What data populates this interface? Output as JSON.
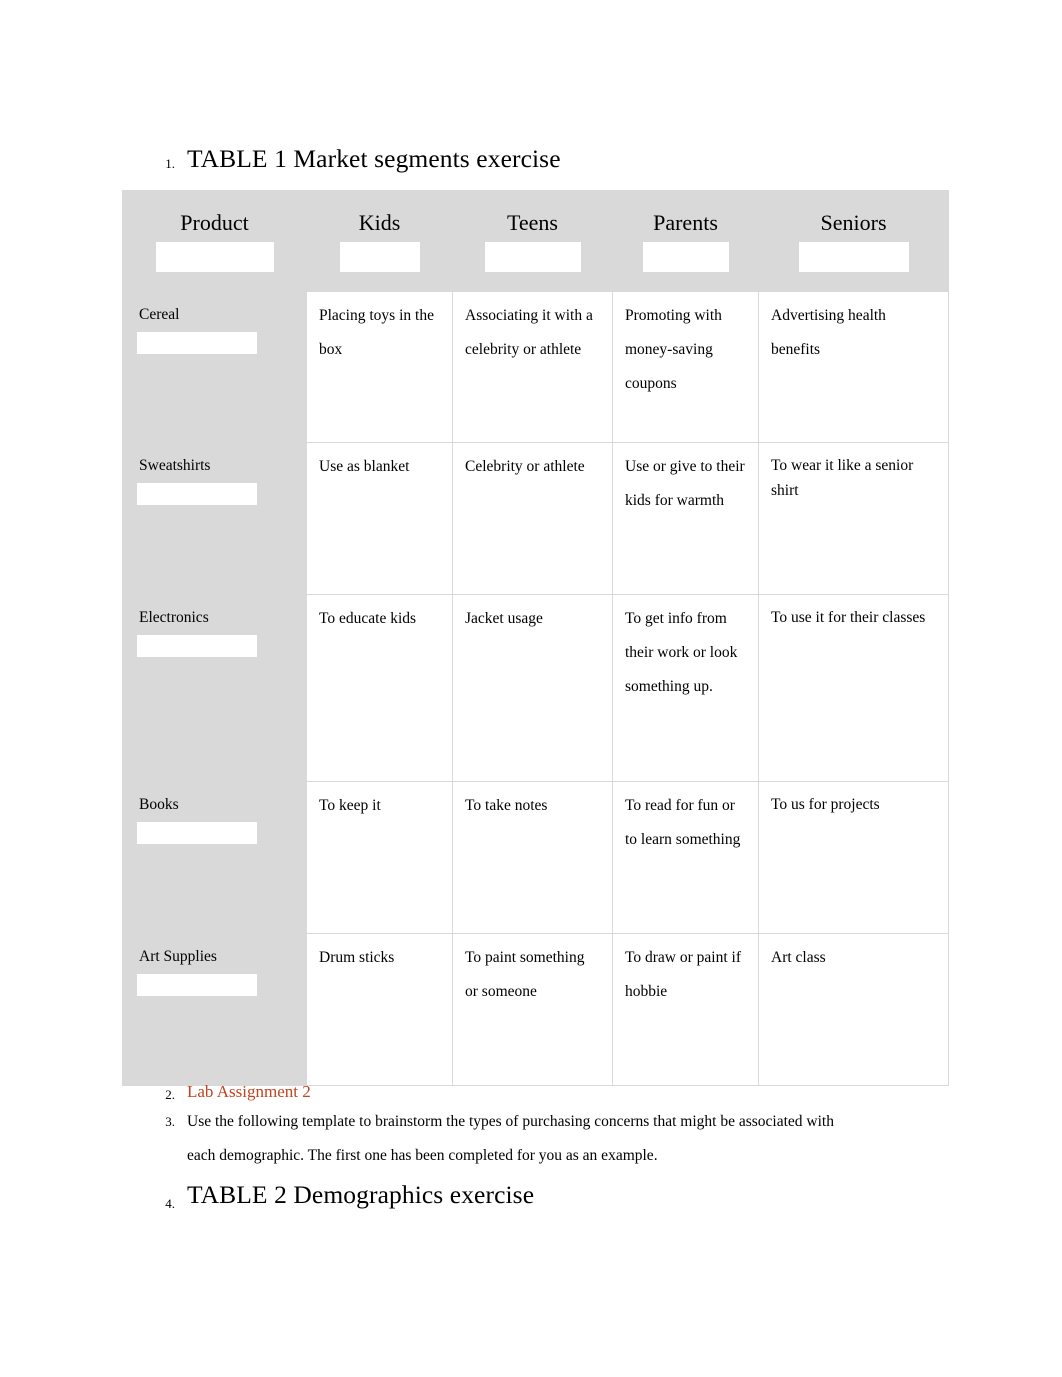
{
  "document": {
    "list_markers": [
      "1.",
      "2.",
      "3.",
      "4."
    ],
    "heading_table1": "TABLE 1 Market segments exercise",
    "lab_assignment_link": "Lab Assignment 2",
    "instructions": "Use the following template to brainstorm the types of purchasing concerns that might be associated with each demographic. The first one has been completed for you as an example.",
    "heading_table2": "TABLE 2 Demographics exercise",
    "accent_color": "#c0441f",
    "header_fill": "#d9d9d9"
  },
  "table1": {
    "headers": [
      "Product",
      "Kids",
      "Teens",
      "Parents",
      "Seniors"
    ],
    "rows": [
      {
        "product": "Cereal",
        "kids": "Placing toys in the box",
        "teens": "Associating it with a celebrity or athlete",
        "parents": "Promoting with money-saving coupons",
        "seniors": "Advertising health benefits"
      },
      {
        "product": "Sweatshirts",
        "kids": "Use as blanket",
        "teens": "Celebrity or athlete",
        "parents": "Use or give to their kids for warmth",
        "seniors": "To wear it like a senior shirt"
      },
      {
        "product": "Electronics",
        "kids": "To educate kids",
        "teens": "Jacket usage",
        "parents": "To get info from their work or look something up.",
        "seniors": "To use it for their classes"
      },
      {
        "product": "Books",
        "kids": "To keep it",
        "teens": "To take notes",
        "parents": "To read for fun or to learn something",
        "seniors": "To us for projects"
      },
      {
        "product": "Art Supplies",
        "kids": "Drum sticks",
        "teens": "To paint something or someone",
        "parents": "To draw or paint if hobbie",
        "seniors": "Art class"
      }
    ]
  }
}
